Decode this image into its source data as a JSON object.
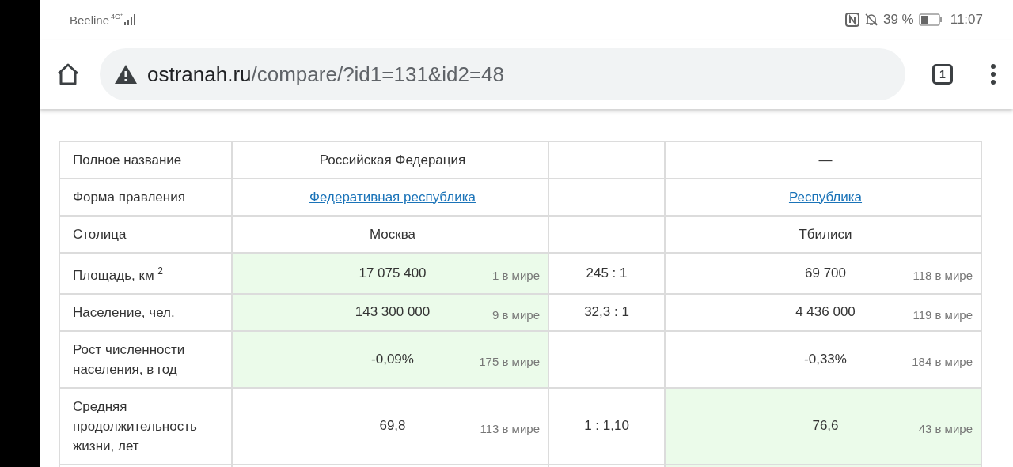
{
  "status_bar": {
    "carrier": "Beeline",
    "network": "4G⁺",
    "battery_percent": "39 %",
    "time": "11:07"
  },
  "browser": {
    "url_host": "ostranah.ru",
    "url_path": "/compare/?id1=131&id2=48",
    "tab_count": "1"
  },
  "rows": [
    {
      "label": "Полное название",
      "left": {
        "value": "Российская Федерация",
        "best": false
      },
      "right": {
        "value": "—",
        "best": false
      }
    },
    {
      "label": "Форма правления",
      "left": {
        "value": "Федеративная республика",
        "link": true,
        "best": false
      },
      "right": {
        "value": "Республика",
        "link": true,
        "best": false
      }
    },
    {
      "label": "Столица",
      "left": {
        "value": "Москва",
        "best": false
      },
      "right": {
        "value": "Тбилиси",
        "best": false
      }
    },
    {
      "label": "Площадь, км $^{2}$",
      "left": {
        "value": "17 075 400",
        "rank": "1 в мире",
        "best": true
      },
      "ratio": "245 : 1",
      "right": {
        "value": "69 700",
        "rank": "118 в мире",
        "best": false
      }
    },
    {
      "label": "Население, чел.",
      "left": {
        "value": "143 300 000",
        "rank": "9 в мире",
        "best": true
      },
      "ratio": "32,3 : 1",
      "right": {
        "value": "4 436 000",
        "rank": "119 в мире",
        "best": false
      }
    },
    {
      "label": "Рост численности населения, в год",
      "left": {
        "value": "-0,09%",
        "rank": "175 в мире",
        "best": true
      },
      "right": {
        "value": "-0,33%",
        "rank": "184 в мире",
        "best": false
      }
    },
    {
      "label": "Средняя продолжительность жизни, лет",
      "left": {
        "value": "69,8",
        "rank": "113 в мире",
        "best": false
      },
      "ratio": "1 : 1,10",
      "right": {
        "value": "76,6",
        "rank": "43 в мире",
        "best": true
      }
    },
    {
      "left": {
        "best": false
      },
      "right": {
        "best": true
      }
    }
  ]
}
